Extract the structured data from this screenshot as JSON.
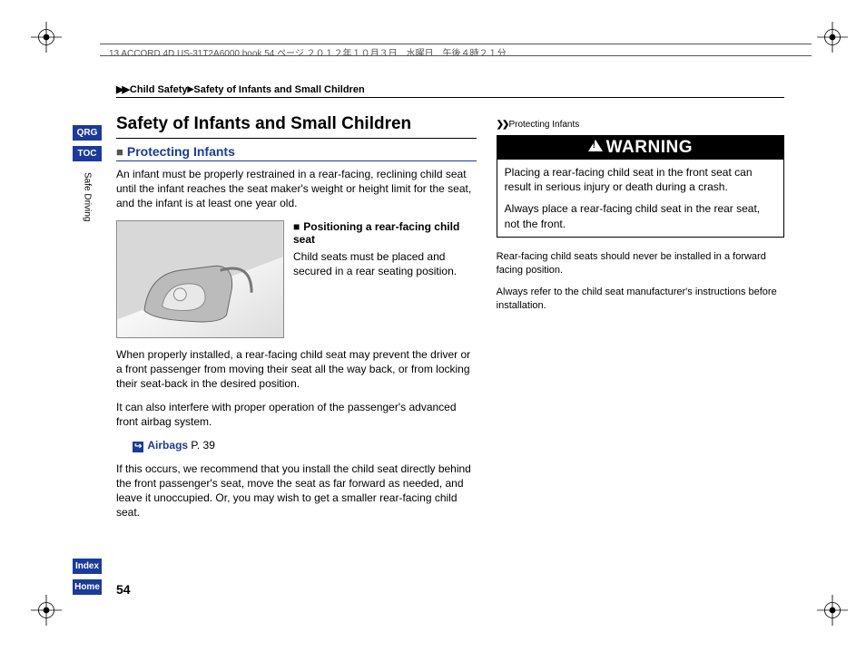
{
  "header_line": "13 ACCORD 4D US-31T2A6000.book  54 ページ  ２０１２年１０月３日　水曜日　午後４時２１分",
  "nav": {
    "qrg": "QRG",
    "toc": "TOC",
    "index": "Index",
    "home": "Home",
    "section": "Safe Driving"
  },
  "breadcrumb": {
    "l1": "Child Safety",
    "l2": "Safety of Infants and Small Children"
  },
  "title": "Safety of Infants and Small Children",
  "subsection_title": "Protecting Infants",
  "p_intro": "An infant must be properly restrained in a rear-facing, reclining child seat until the infant reaches the seat maker's weight or height limit for the seat, and the infant is at least one year old.",
  "fig_title": "Positioning a rear-facing child seat",
  "fig_caption": "Child seats must be placed and secured in a rear seating position.",
  "p2": "When properly installed, a rear-facing child seat may prevent the driver or a front passenger from moving their seat all the way back, or from locking their seat-back in the desired position.",
  "p3": "It can also interfere with proper operation of the passenger's advanced front airbag system.",
  "xref": {
    "label": "Airbags",
    "page": "P. 39"
  },
  "p4": "If this occurs, we recommend that you install the child seat directly behind the front passenger's seat, move the seat as far forward as needed, and leave it unoccupied. Or, you may wish to get a smaller rear-facing child seat.",
  "side_crumb": "Protecting Infants",
  "warning": {
    "head": "WARNING",
    "b1": "Placing a rear-facing child seat in the front seat can result in serious injury or death during a crash.",
    "b2": "Always place a rear-facing child seat in the rear seat, not the front."
  },
  "note1": "Rear-facing child seats should never be installed in a forward facing position.",
  "note2": "Always refer to the child seat manufacturer's instructions before installation.",
  "page_number": "54"
}
